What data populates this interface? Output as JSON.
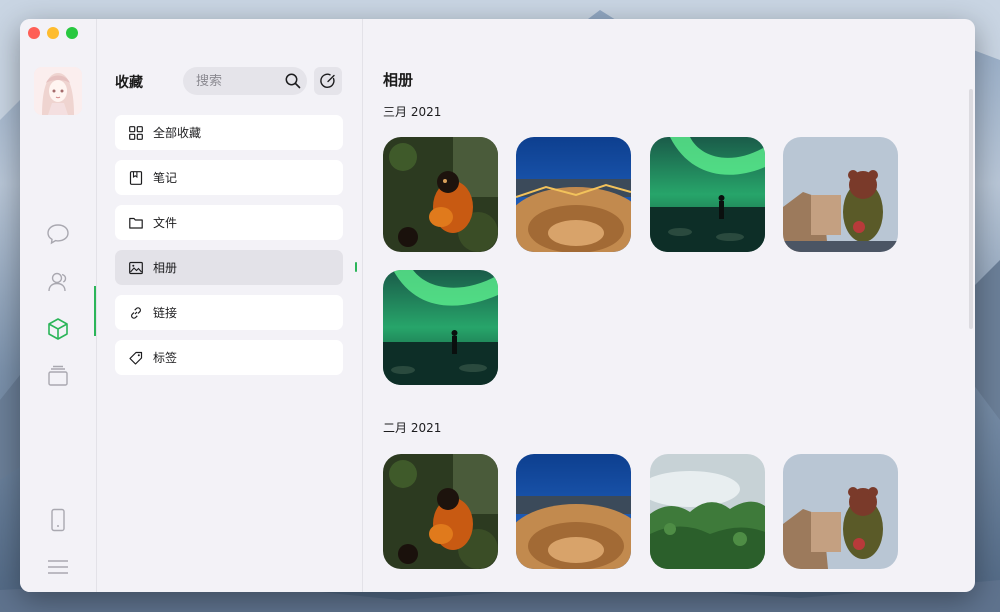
{
  "window": {
    "traffic_lights": [
      "close",
      "minimize",
      "maximize"
    ]
  },
  "rail": {
    "items": [
      {
        "icon": "chat-bubble-icon"
      },
      {
        "icon": "contacts-icon"
      },
      {
        "icon": "favorites-cube-icon",
        "active": true
      },
      {
        "icon": "folder-stack-icon"
      },
      {
        "icon": "phone-icon"
      },
      {
        "icon": "menu-icon"
      }
    ],
    "accent": "#2bb559"
  },
  "sidebar": {
    "title": "收藏",
    "search_placeholder": "搜索",
    "items": [
      {
        "label": "全部收藏",
        "icon": "grid-icon"
      },
      {
        "label": "笔记",
        "icon": "note-icon"
      },
      {
        "label": "文件",
        "icon": "folder-icon"
      },
      {
        "label": "相册",
        "icon": "image-icon",
        "active": true
      },
      {
        "label": "链接",
        "icon": "link-icon"
      },
      {
        "label": "标签",
        "icon": "tag-icon"
      }
    ]
  },
  "main": {
    "title": "相册",
    "sections": [
      {
        "label": "三月 2021",
        "photos": [
          "monkey",
          "theatre",
          "aurora",
          "bear-sculpture",
          "aurora"
        ]
      },
      {
        "label": "二月 2021",
        "photos": [
          "monkey",
          "theatre",
          "forest",
          "bear-sculpture"
        ]
      }
    ]
  }
}
